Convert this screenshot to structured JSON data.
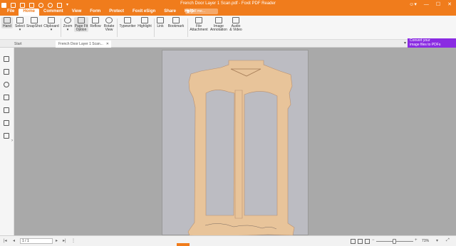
{
  "app": {
    "title": "French Door Layer 1 Scan.pdf - Foxit PDF Reader",
    "tell_me_placeholder": "Tell me..."
  },
  "menu": [
    "File",
    "Home",
    "Comment",
    "View",
    "Form",
    "Protect",
    "Foxit eSign",
    "Share",
    "Help"
  ],
  "active_menu": "Home",
  "ribbon": {
    "hand": "Hand",
    "select": "Select",
    "snapshot": "SnapShot",
    "clipboard": "Clipboard",
    "zoom": "Zoom",
    "page_fit_line1": "Page Fit",
    "page_fit_line2": "Option",
    "reflow": "Reflow",
    "rotate_line1": "Rotate",
    "rotate_line2": "View",
    "typewriter": "Typewriter",
    "highlight": "Highlight",
    "link": "Link",
    "bookmark": "Bookmark",
    "file_attachment_line1": "File",
    "file_attachment_line2": "Attachment",
    "image_annotation_line1": "Image",
    "image_annotation_line2": "Annotation",
    "audio_video_line1": "Audio",
    "audio_video_line2": "& Video"
  },
  "promo": {
    "line1": "Convert your",
    "line2": "image files to PDFs"
  },
  "tabs": {
    "start": "Start",
    "document": "French Door Layer 1 Scan..."
  },
  "status": {
    "page_value": "1 / 1",
    "zoom_value": "71%",
    "zoom_level": 0.71
  },
  "colors": {
    "brand": "#f07c1c",
    "promo": "#8a2be2",
    "wood": "#e8c49a"
  }
}
